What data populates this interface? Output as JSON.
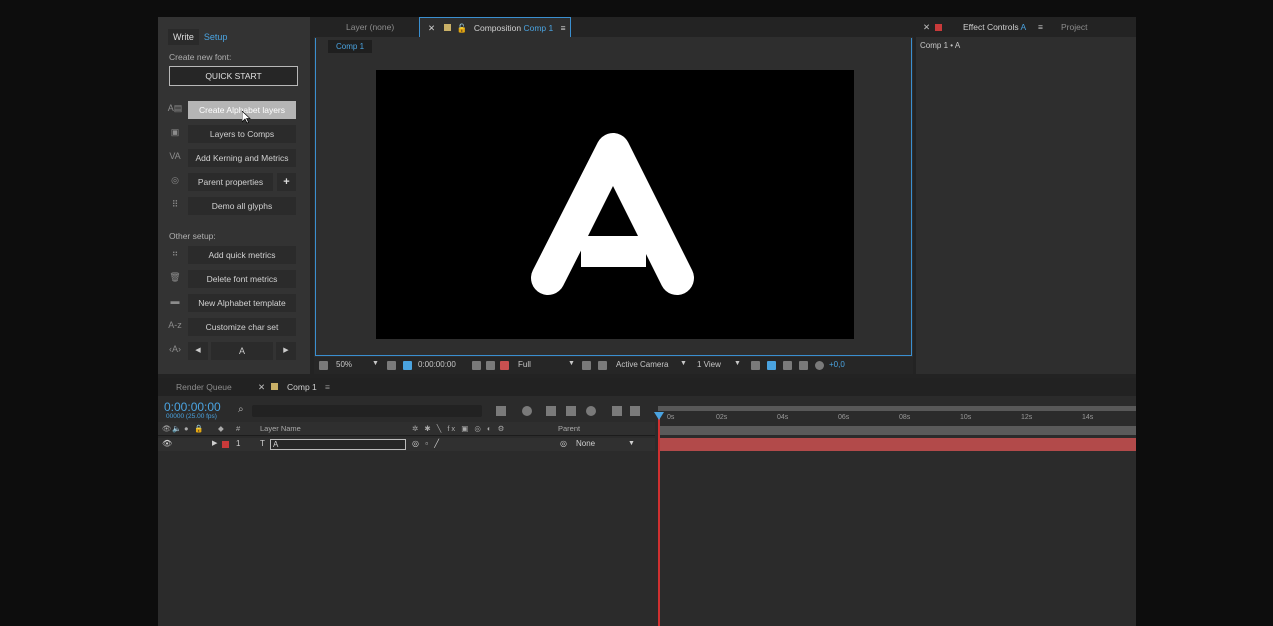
{
  "left_panel": {
    "tabs": [
      "Write",
      "Setup"
    ],
    "create_new_font_label": "Create new font:",
    "quick_start_label": "QUICK START",
    "buttons": [
      {
        "icon": "alphabet-layers-icon",
        "icon_glyph": "A▤",
        "label": "Create Alphabet layers"
      },
      {
        "icon": "layers-to-comps-icon",
        "icon_glyph": "▣",
        "label": "Layers to Comps"
      },
      {
        "icon": "kerning-icon",
        "icon_glyph": "VA",
        "label": "Add Kerning and Metrics"
      },
      {
        "icon": "parent-icon",
        "icon_glyph": "◎",
        "label": "Parent properties"
      },
      {
        "icon": "grid-dots-icon",
        "icon_glyph": "⠿",
        "label": "Demo all glyphs"
      }
    ],
    "plus_label": "+",
    "other_setup_label": "Other setup:",
    "other_buttons": [
      {
        "icon": "quick-metrics-icon",
        "icon_glyph": "⠶",
        "label": "Add quick metrics"
      },
      {
        "icon": "trash-icon",
        "icon_glyph": "🗑",
        "label": "Delete font metrics"
      },
      {
        "icon": "folder-icon",
        "icon_glyph": "▬",
        "label": "New Alphabet template"
      },
      {
        "icon": "az-icon",
        "icon_glyph": "A-z",
        "label": "Customize char set"
      }
    ],
    "char_stepper": {
      "icon_glyph": "‹A›",
      "value": "A"
    }
  },
  "comp_panel": {
    "layer_tab": "Layer  (none)",
    "comp_tab_label": "Composition",
    "comp_tab_name": "Comp 1",
    "sub_tab": "Comp 1",
    "glyph": "A",
    "toolbar": {
      "zoom": "50%",
      "timecode": "0:00:00:00",
      "resolution": "Full",
      "camera": "Active Camera",
      "views": "1 View",
      "exposure": "+0,0"
    }
  },
  "fx_panel": {
    "tab_label": "Effect Controls",
    "tab_name": "A",
    "project_tab": "Project",
    "breadcrumb": "Comp 1 • A"
  },
  "timeline": {
    "render_queue_tab": "Render Queue",
    "comp_tab": "Comp 1",
    "timecode": "0:00:00:00",
    "fps": "00000 (25.00 fps)",
    "search_placeholder": "",
    "col_hash": "#",
    "col_layer_name": "Layer Name",
    "col_parent": "Parent",
    "layer": {
      "index": "1",
      "name": "A",
      "parent": "None"
    },
    "ruler_ticks": [
      "0s",
      "02s",
      "04s",
      "06s",
      "08s",
      "10s",
      "12s",
      "14s"
    ]
  },
  "colors": {
    "accent": "#4aa3e0",
    "layer_bar": "#b24a4a",
    "timeline_red": "#d03030"
  }
}
